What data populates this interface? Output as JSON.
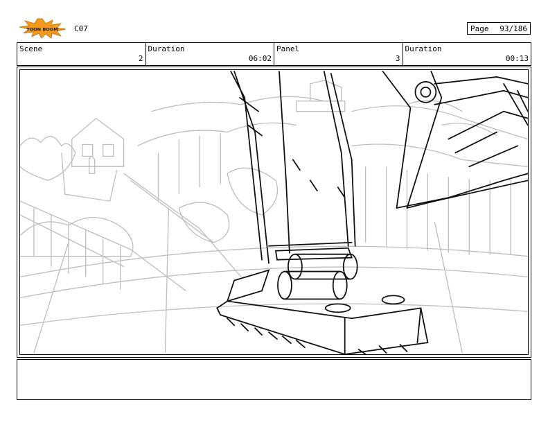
{
  "header": {
    "logo_text": "TOON BOOM",
    "scene_code": "C07",
    "page_label": "Page",
    "page_number": "93/186"
  },
  "info_bar": [
    {
      "label": "Scene",
      "value": "2"
    },
    {
      "label": "Duration",
      "value": "06:02"
    },
    {
      "label": "Panel",
      "value": "3"
    },
    {
      "label": "Duration",
      "value": "00:13"
    }
  ],
  "colors": {
    "sketch_gray": "#bdbdbd",
    "ink_black": "#111111",
    "logo_orange": "#f39a1c"
  }
}
